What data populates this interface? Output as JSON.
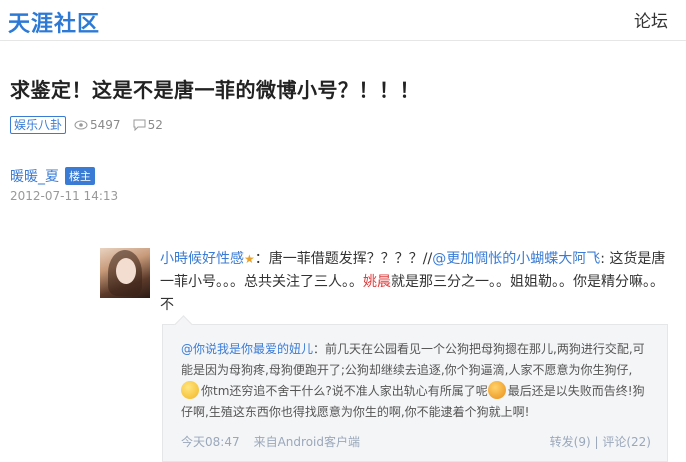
{
  "header": {
    "logo": "天涯社区",
    "nav_forum": "论坛"
  },
  "post": {
    "title": "求鉴定！这是不是唐一菲的微博小号？！！！",
    "tag": "娱乐八卦",
    "views": "5497",
    "replies": "52",
    "author": "暖暖_夏",
    "author_badge": "楼主",
    "date": "2012-07-11 14:13"
  },
  "weibo": {
    "user": "小時候好性感",
    "text1": "：唐一菲借题发挥？？？？//",
    "mention": "@更加惆怅的小蝴蝶大阿飞",
    "text2": ": 这货是唐一菲小号。。。总共关注了三人。。",
    "highlight": "姚晨",
    "text3": "就是那三分之一。。姐姐勒。。你是精分嘛。。不",
    "quote": {
      "mention": "@你说我是你最爱的妞儿",
      "part1": "：前几天在公园看见一个公狗把母狗摁在那儿,两狗进行交配,可能是因为母狗疼,母狗便跑开了;公狗却继续去追逐,你个狗逼滴,人家不愿意为你生狗仔,",
      "part2": "你tm还穷追不舍干什么?说不准人家出轨心有所属了呢",
      "part3": "最后还是以失败而告终!狗仔啊,生殖这东西你也得找愿意为你生的啊,你不能逮着个狗就上啊!",
      "time": "今天08:47",
      "source": "来自Android客户端",
      "repost": "转发(9)",
      "sep": "|",
      "comment": "评论(22)"
    }
  },
  "colors": {
    "brand": "#2d7ad6",
    "link": "#3a7bd5",
    "highlight": "#e03c3c"
  }
}
